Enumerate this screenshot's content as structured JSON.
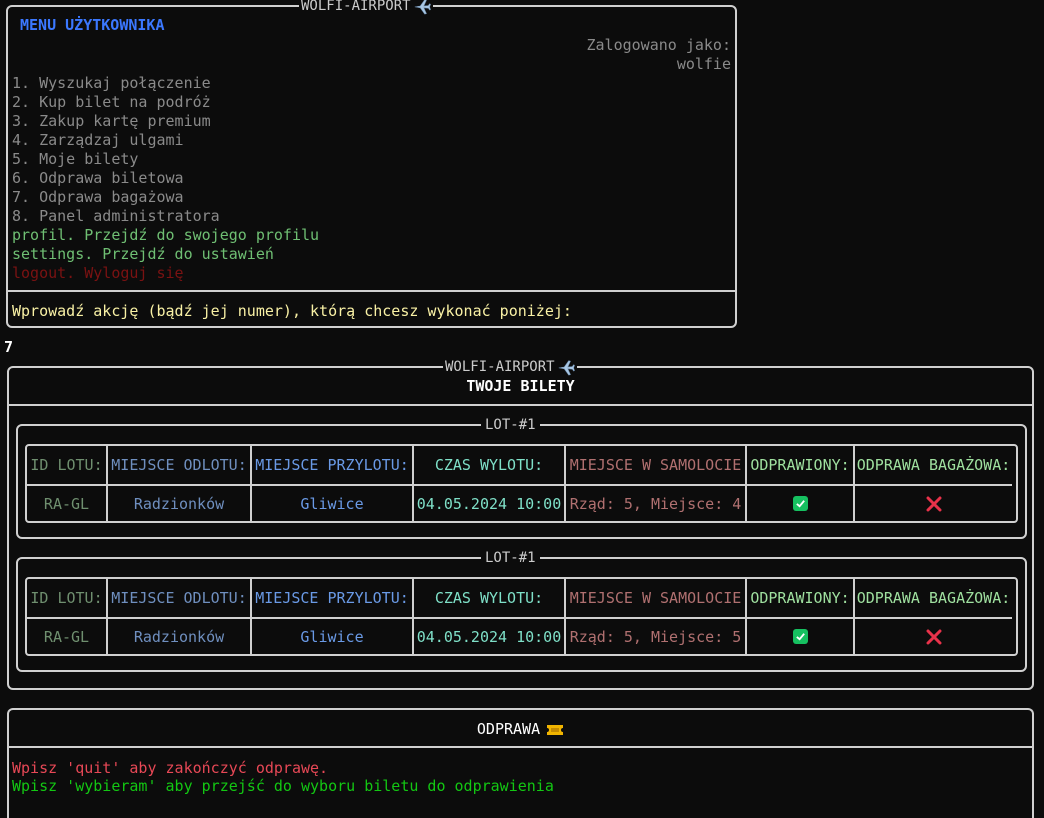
{
  "app_title": "WOLFI-AIRPORT",
  "menu": {
    "heading": "MENU UŻYTKOWNIKA",
    "logged_label": "Zalogowano jako:",
    "username": "wolfie",
    "items": [
      {
        "label": "1. Wyszukaj połączenie"
      },
      {
        "label": "2. Kup bilet na podróż"
      },
      {
        "label": "3. Zakup kartę premium"
      },
      {
        "label": "4. Zarządzaj ulgami"
      },
      {
        "label": "5. Moje bilety"
      },
      {
        "label": "6. Odprawa biletowa"
      },
      {
        "label": "7. Odprawa bagażowa"
      },
      {
        "label": "8. Panel administratora"
      }
    ],
    "profile": "profil. Przejdź do swojego profilu",
    "settings": "settings. Przejdź do ustawień",
    "logout": "logout. Wyloguj się",
    "prompt": "Wprowadź akcję (bądź jej numer), którą chcesz wykonać poniżej:"
  },
  "user_input": "7",
  "tickets_panel": {
    "title": "TWOJE BILETY",
    "columns": [
      "ID LOTU:",
      "MIEJSCE ODLOTU:",
      "MIEJSCE PRZYLOTU:",
      "CZAS WYLOTU:",
      "MIEJSCE W SAMOLOCIE",
      "ODPRAWIONY:",
      "ODPRAWA BAGAŻOWA:"
    ],
    "flights": [
      {
        "frame_label": "LOT-#1",
        "id": "RA-GL",
        "from": "Radzionków",
        "to": "Gliwice",
        "time": "04.05.2024 10:00",
        "seat": "Rząd: 5, Miejsce: 4",
        "checked_in": true,
        "baggage": false
      },
      {
        "frame_label": "LOT-#1",
        "id": "RA-GL",
        "from": "Radzionków",
        "to": "Gliwice",
        "time": "04.05.2024 10:00",
        "seat": "Rząd: 5, Miejsce: 5",
        "checked_in": true,
        "baggage": false
      }
    ],
    "icons": {
      "checked": "check-icon",
      "not_checked": "cross-icon"
    }
  },
  "checkin_panel": {
    "title": "ODPRAWA",
    "title_icon": "ticket-icon",
    "quit_hint": "Wpisz 'quit' aby zakończyć odprawę.",
    "choose_hint": "Wpisz 'wybieram' aby przejść do wyboru biletu do odprawienia"
  },
  "colors": {
    "heading_blue": "#3b78ff",
    "prompt_yellow": "#f9f1a5",
    "menu_green": "#6fbf73",
    "logout_red": "#7a1212",
    "check_green": "#16c060",
    "cross_red": "#e8324a"
  }
}
